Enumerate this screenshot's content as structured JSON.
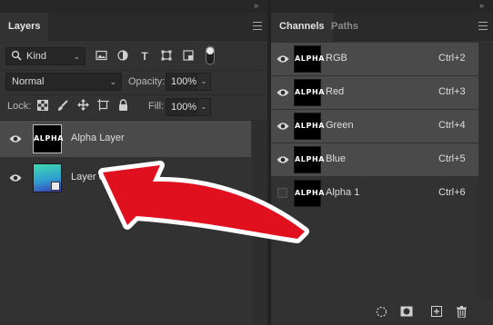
{
  "layers_panel": {
    "tab_label": "Layers",
    "kind_filter": {
      "label": "Kind",
      "icon": "search-icon"
    },
    "filter_icons": [
      "image-filter-icon",
      "adjustment-filter-icon",
      "type-filter-icon",
      "shape-filter-icon",
      "smart-object-filter-icon",
      "filter-toggle-icon"
    ],
    "blend_mode": "Normal",
    "opacity": {
      "label": "Opacity:",
      "value": "100%"
    },
    "lock": {
      "label": "Lock:",
      "icons": [
        "lock-pixels-icon",
        "lock-image-icon",
        "lock-position-icon",
        "lock-artboard-icon",
        "lock-all-icon"
      ]
    },
    "fill": {
      "label": "Fill:",
      "value": "100%"
    },
    "layers": [
      {
        "name": "Alpha Layer",
        "thumb_text": "ALPHA",
        "selected": true
      },
      {
        "name": "Layer 0",
        "thumb_text": "",
        "selected": false
      }
    ]
  },
  "channels_panel": {
    "tabs": [
      {
        "label": "Channels",
        "active": true
      },
      {
        "label": "Paths",
        "active": false
      }
    ],
    "channels": [
      {
        "name": "RGB",
        "shortcut": "Ctrl+2",
        "visible": true
      },
      {
        "name": "Red",
        "shortcut": "Ctrl+3",
        "visible": true
      },
      {
        "name": "Green",
        "shortcut": "Ctrl+4",
        "visible": true
      },
      {
        "name": "Blue",
        "shortcut": "Ctrl+5",
        "visible": true
      },
      {
        "name": "Alpha 1",
        "shortcut": "Ctrl+6",
        "visible": false
      }
    ],
    "thumb_text": "ALPHA",
    "bottom_icons": [
      "load-selection-icon",
      "save-selection-icon",
      "new-channel-icon",
      "delete-channel-icon"
    ]
  },
  "colors": {
    "panel_bg": "#323232",
    "selected_row": "#4a4a4a",
    "arrow_red": "#e0101e",
    "gradient_start": "#3fd8b0",
    "gradient_end": "#3a3fb8"
  }
}
